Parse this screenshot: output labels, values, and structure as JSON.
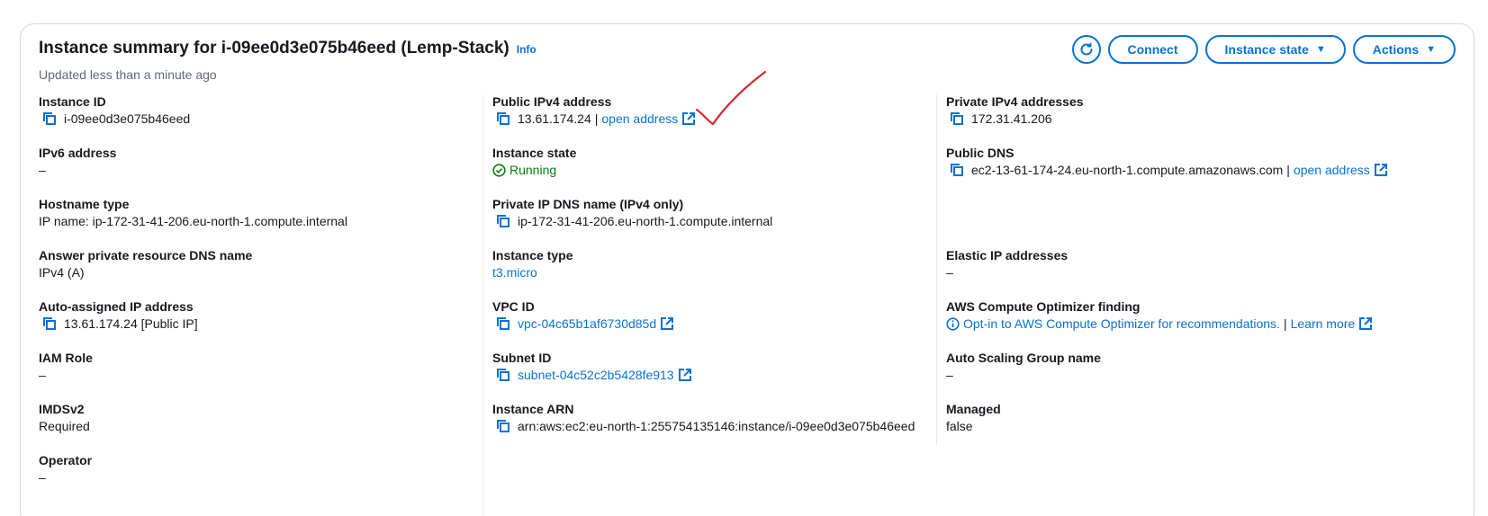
{
  "header": {
    "title": "Instance summary for i-09ee0d3e075b46eed (Lemp-Stack)",
    "info_label": "Info",
    "updated": "Updated less than a minute ago"
  },
  "buttons": {
    "refresh_icon": "refresh-icon",
    "connect": "Connect",
    "instance_state": "Instance state",
    "actions": "Actions"
  },
  "col1": {
    "instance_id": {
      "label": "Instance ID",
      "value": "i-09ee0d3e075b46eed"
    },
    "ipv6": {
      "label": "IPv6 address",
      "value": "–"
    },
    "hostname_type": {
      "label": "Hostname type",
      "value": "IP name: ip-172-31-41-206.eu-north-1.compute.internal"
    },
    "answer_dns": {
      "label": "Answer private resource DNS name",
      "value": "IPv4 (A)"
    },
    "auto_ip": {
      "label": "Auto-assigned IP address",
      "value": "13.61.174.24 [Public IP]"
    },
    "iam_role": {
      "label": "IAM Role",
      "value": "–"
    },
    "imdsv2": {
      "label": "IMDSv2",
      "value": "Required"
    },
    "operator": {
      "label": "Operator",
      "value": "–"
    }
  },
  "col2": {
    "public_ipv4": {
      "label": "Public IPv4 address",
      "value": "13.61.174.24",
      "link": "open address"
    },
    "instance_state": {
      "label": "Instance state",
      "value": "Running"
    },
    "private_dns": {
      "label": "Private IP DNS name (IPv4 only)",
      "value": "ip-172-31-41-206.eu-north-1.compute.internal"
    },
    "instance_type": {
      "label": "Instance type",
      "value": "t3.micro"
    },
    "vpc_id": {
      "label": "VPC ID",
      "value": "vpc-04c65b1af6730d85d"
    },
    "subnet_id": {
      "label": "Subnet ID",
      "value": "subnet-04c52c2b5428fe913"
    },
    "arn": {
      "label": "Instance ARN",
      "value": "arn:aws:ec2:eu-north-1:255754135146:instance/i-09ee0d3e075b46eed"
    }
  },
  "col3": {
    "private_ipv4": {
      "label": "Private IPv4 addresses",
      "value": "172.31.41.206"
    },
    "public_dns": {
      "label": "Public DNS",
      "value": "ec2-13-61-174-24.eu-north-1.compute.amazonaws.com",
      "link": "open address"
    },
    "elastic_ip": {
      "label": "Elastic IP addresses",
      "value": "–"
    },
    "optimizer": {
      "label": "AWS Compute Optimizer finding",
      "value": "Opt-in to AWS Compute Optimizer for recommendations.",
      "link": "Learn more"
    },
    "asg": {
      "label": "Auto Scaling Group name",
      "value": "–"
    },
    "managed": {
      "label": "Managed",
      "value": "false"
    }
  },
  "colors": {
    "link": "#0972d3",
    "success": "#037f0c",
    "annotation": "#e0232e"
  }
}
